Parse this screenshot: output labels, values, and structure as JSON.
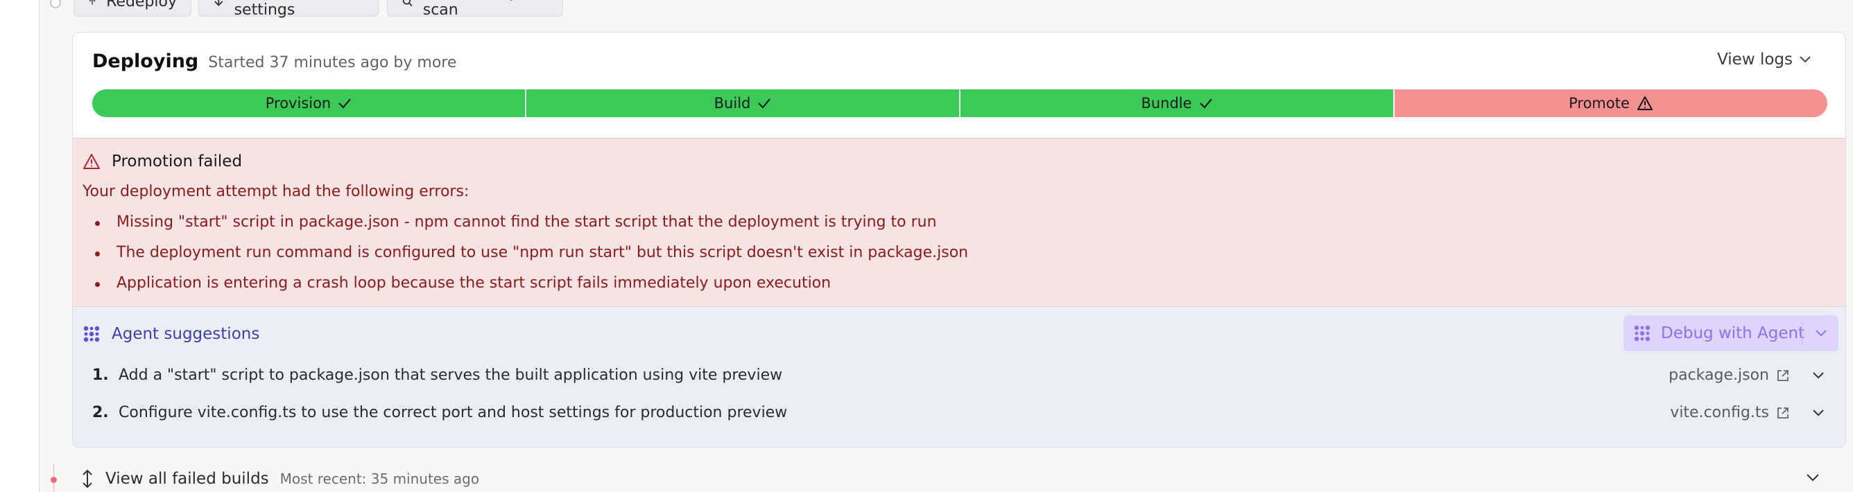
{
  "toolbar": {
    "redeploy_label": "Redeploy",
    "advanced_label": "Advanced settings",
    "security_label": "Run security scan"
  },
  "deploy": {
    "status": "Deploying",
    "subtitle": "Started 37 minutes ago by more",
    "view_logs_label": "View logs",
    "steps": [
      {
        "label": "Provision",
        "state": "done"
      },
      {
        "label": "Build",
        "state": "done"
      },
      {
        "label": "Bundle",
        "state": "done"
      },
      {
        "label": "Promote",
        "state": "failed"
      }
    ]
  },
  "error": {
    "title": "Promotion failed",
    "lead": "Your deployment attempt had the following errors:",
    "items": [
      "Missing \"start\" script in package.json - npm cannot find the start script that the deployment is trying to run",
      "The deployment run command is configured to use \"npm run start\" but this script doesn't exist in package.json",
      "Application is entering a crash loop because the start script fails immediately upon execution"
    ]
  },
  "agent": {
    "title": "Agent suggestions",
    "debug_label": "Debug with Agent",
    "suggestions": [
      {
        "num": "1.",
        "text": "Add a \"start\" script to package.json that serves the built application using vite preview",
        "file": "package.json"
      },
      {
        "num": "2.",
        "text": "Configure vite.config.ts to use the correct port and host settings for production preview",
        "file": "vite.config.ts"
      }
    ]
  },
  "failed_builds": {
    "title": "View all failed builds",
    "subtitle": "Most recent: 35 minutes ago"
  },
  "colors": {
    "step_done": "#3bc957",
    "step_failed": "#f59091",
    "error_bg": "#f6e3e4",
    "error_text": "#8b1a1a",
    "agent_bg": "#eceef6",
    "agent_accent": "#3b3fa6",
    "debug_button_bg": "#ddd5fb"
  },
  "icons": {
    "step_done": "check-icon",
    "step_failed": "warning-icon",
    "error_title": "warning-icon",
    "agent": "agent-grid-icon",
    "external": "external-link-icon",
    "chevron": "chevron-down-icon",
    "expand": "expand-vertical-icon"
  }
}
